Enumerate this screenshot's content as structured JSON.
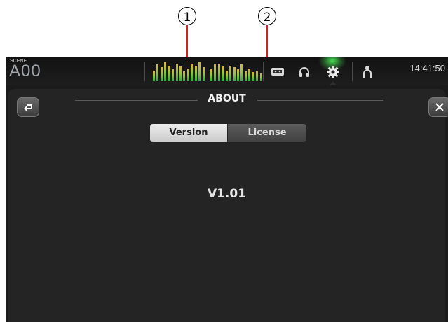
{
  "callouts": [
    "1",
    "2"
  ],
  "topbar": {
    "scene_label": "SCENE",
    "scene_name": "A00",
    "clock": "14:41:50",
    "meter_levels": [
      0.55,
      0.85,
      0.7,
      0.95,
      0.8,
      0.6,
      0.9,
      0.75,
      0.5,
      0.65,
      0.9,
      0.8,
      0.95,
      0.7,
      0.6,
      0.85,
      0.9,
      0.75,
      0.55,
      0.8,
      0.7,
      0.6,
      0.85,
      0.5,
      0.65,
      0.45,
      0.55,
      0.4
    ],
    "icons": [
      "recorder-icon",
      "headphones-icon",
      "gear-icon",
      "user-icon"
    ],
    "accent_color": "#50ff5a"
  },
  "window": {
    "title": "ABOUT",
    "back_icon": "back-arrow-icon",
    "close_icon": "close-icon"
  },
  "tabs": [
    {
      "label": "Version",
      "active": true
    },
    {
      "label": "License",
      "active": false
    }
  ],
  "version": {
    "value": "V1.01"
  }
}
